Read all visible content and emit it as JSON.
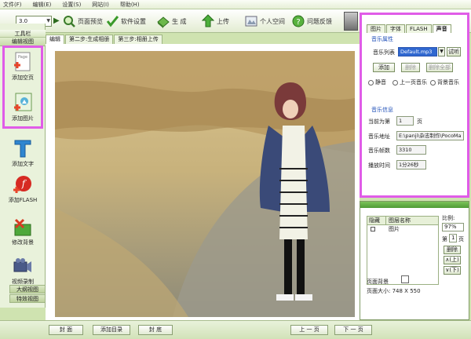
{
  "menu": [
    "文件(F)",
    "编辑(E)",
    "设置(S)",
    "网站(I)",
    "帮助(H)"
  ],
  "toolbar": {
    "combo_value": "3.0",
    "buttons": [
      {
        "label": "页面预览",
        "icon": "magnifier-icon"
      },
      {
        "label": "软件设置",
        "icon": "checkmark-icon"
      },
      {
        "label": "生 成",
        "icon": "generate-icon"
      },
      {
        "label": "上传",
        "icon": "upload-arrow-icon"
      },
      {
        "label": "个人空间",
        "icon": "person-space-icon"
      },
      {
        "label": "问题反馈",
        "icon": "question-icon"
      }
    ]
  },
  "left_panel": {
    "header": "工具栏",
    "subheader": "编辑视图",
    "tools": [
      {
        "label": "添加空页",
        "icon": "blank-page-icon"
      },
      {
        "label": "添加图片",
        "icon": "add-picture-icon"
      },
      {
        "label": "添加文字",
        "icon": "text-t-icon"
      },
      {
        "label": "添加FLASH",
        "icon": "flash-icon"
      },
      {
        "label": "修改背景",
        "icon": "background-edit-icon"
      },
      {
        "label": "视频录制",
        "icon": "video-camera-icon"
      }
    ],
    "bottom_tabs": [
      "大纲视图",
      "特效视图"
    ]
  },
  "steps": [
    "编辑",
    "第二步:生成相册",
    "第三步:相册上传"
  ],
  "props": {
    "tabs": [
      "图片",
      "字体",
      "FLASH",
      "声音"
    ],
    "music_section": "音乐属性",
    "music_list_label": "音乐列表",
    "music_list_value": "Default.mp3",
    "listen_btn": "试听",
    "add_btn": "添加",
    "delete_btn": "删除",
    "delete_all_btn": "删除全部",
    "radio_options": [
      "静音",
      "上一页音乐",
      "背景音乐"
    ],
    "info_section": "音乐信息",
    "current_label": "当前为第",
    "current_value": "1",
    "page_unit": "页",
    "address_label": "音乐地址",
    "address_value": "E:\\panji\\杂志制作\\PocoMa",
    "frames_label": "音乐帧数",
    "frames_value": "3310",
    "duration_label": "播放时间",
    "duration_value": "1分26秒"
  },
  "layers": {
    "col_hide": "隐藏",
    "col_name": "图层名称",
    "rows": [
      {
        "name": "图片"
      }
    ],
    "ratio_label": "比例:",
    "ratio_value": "97%",
    "page_prefix": "第",
    "page_value": "1",
    "page_suffix": "页",
    "delete_btn": "删除",
    "up_btn": "∧(上)",
    "down_btn": "∨(下)",
    "bg_label": "页面背景",
    "size_label": "页面大小: 748 X 550"
  },
  "bottom": {
    "cover": "封 面",
    "add_toc": "添加目录",
    "back_cover": "封 底",
    "prev": "上 一 页",
    "next": "下 一 页"
  },
  "colors": {
    "highlight": "#e05ce8",
    "panel_green": "#cfe3b0",
    "accent_blue": "#2050b8"
  }
}
